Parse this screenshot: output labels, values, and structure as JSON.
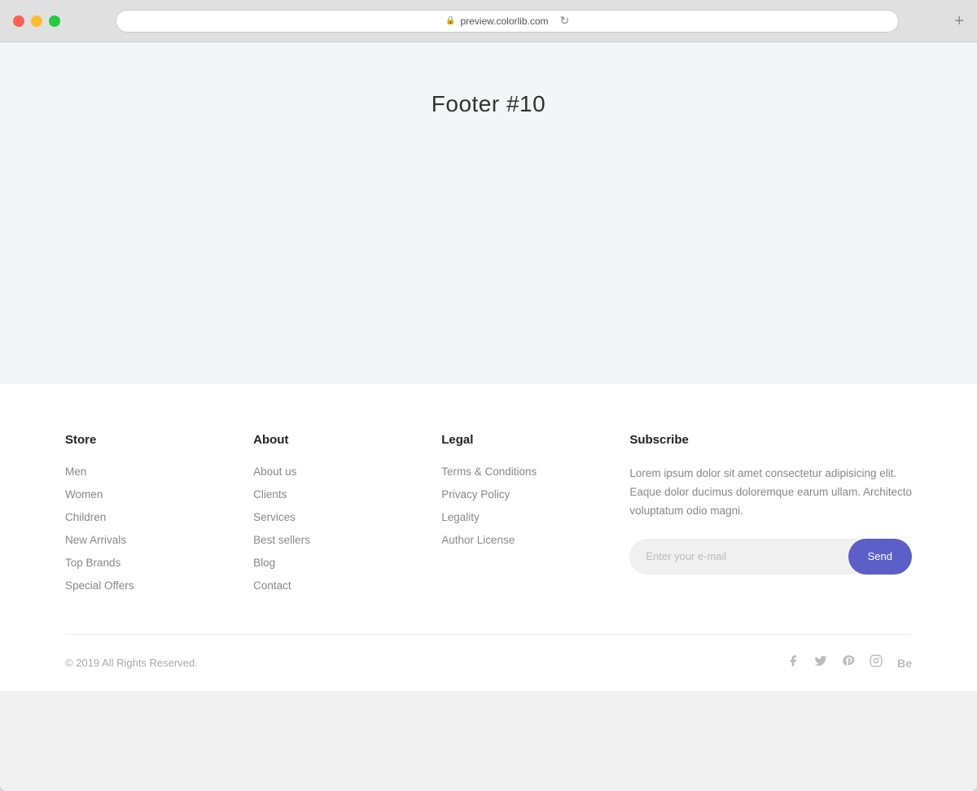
{
  "browser": {
    "url": "preview.colorlib.com",
    "new_tab_symbol": "+"
  },
  "page": {
    "title": "Footer #10"
  },
  "footer": {
    "store": {
      "heading": "Store",
      "links": [
        "Men",
        "Women",
        "Children",
        "New Arrivals",
        "Top Brands",
        "Special Offers"
      ]
    },
    "about": {
      "heading": "About",
      "links": [
        "About us",
        "Clients",
        "Services",
        "Best sellers",
        "Blog",
        "Contact"
      ]
    },
    "legal": {
      "heading": "Legal",
      "links": [
        "Terms & Conditions",
        "Privacy Policy",
        "Legality",
        "Author License"
      ]
    },
    "subscribe": {
      "heading": "Subscribe",
      "description": "Lorem ipsum dolor sit amet consectetur adipisicing elit. Eaque dolor ducimus doloremque earum ullam. Architecto voluptatum odio magni.",
      "input_placeholder": "Enter your e-mail",
      "button_label": "Send"
    },
    "bottom": {
      "copyright": "© 2019 All Rights Reserved."
    }
  }
}
